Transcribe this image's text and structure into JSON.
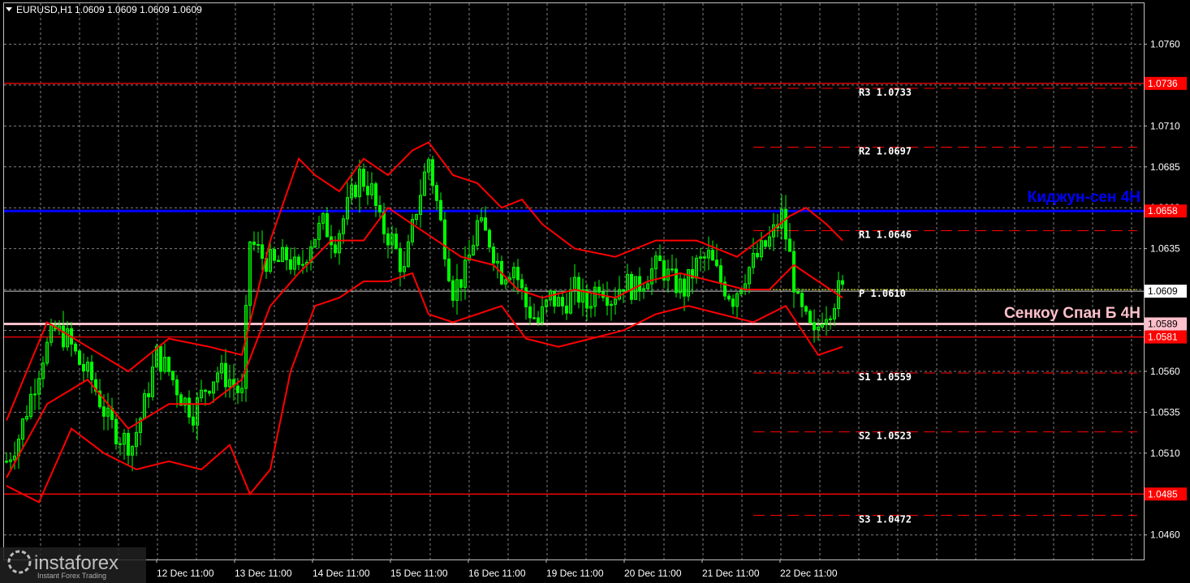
{
  "header": {
    "symbol": "EURUSD,H1",
    "ohlc": "1.0609 1.0609 1.0609 1.0609"
  },
  "watermark": {
    "brand": "instaforex",
    "tagline": "Instant Forex Trading"
  },
  "colors": {
    "background": "#000000",
    "grid": "#7f7f7f",
    "candle": "#00ff00",
    "bands": "#ff0000",
    "kijun": "#0000ff",
    "senkou": "#ffc0cb",
    "pivot": "#ffff00",
    "levels": "#ff0000"
  },
  "chart_data": {
    "type": "candlestick",
    "title": "EURUSD,H1",
    "ylim": [
      1.0445,
      1.0785
    ],
    "y_ticks": [
      "1.0760",
      "1.0735",
      "1.0710",
      "1.0685",
      "1.0660",
      "1.0635",
      "1.0610",
      "1.0585",
      "1.0560",
      "1.0535",
      "1.0510",
      "1.0485",
      "1.0460"
    ],
    "x_ticks": [
      "12 Dec 11:00",
      "13 Dec 11:00",
      "14 Dec 11:00",
      "15 Dec 11:00",
      "16 Dec 11:00",
      "19 Dec 11:00",
      "20 Dec 11:00",
      "21 Dec 11:00",
      "22 Dec 11:00"
    ],
    "price_path": [
      [
        0,
        1.0505
      ],
      [
        3,
        1.052
      ],
      [
        6,
        1.0545
      ],
      [
        9,
        1.057
      ],
      [
        12,
        1.0585
      ],
      [
        15,
        1.058
      ],
      [
        18,
        1.0565
      ],
      [
        21,
        1.0555
      ],
      [
        25,
        1.053
      ],
      [
        28,
        1.052
      ],
      [
        31,
        1.0515
      ],
      [
        34,
        1.054
      ],
      [
        37,
        1.057
      ],
      [
        40,
        1.056
      ],
      [
        43,
        1.0545
      ],
      [
        46,
        1.0535
      ],
      [
        49,
        1.055
      ],
      [
        52,
        1.056
      ],
      [
        55,
        1.0555
      ],
      [
        58,
        1.0545
      ],
      [
        60,
        1.064
      ],
      [
        63,
        1.063
      ],
      [
        66,
        1.0625
      ],
      [
        69,
        1.063
      ],
      [
        72,
        1.062
      ],
      [
        75,
        1.064
      ],
      [
        78,
        1.065
      ],
      [
        81,
        1.064
      ],
      [
        84,
        1.066
      ],
      [
        87,
        1.068
      ],
      [
        90,
        1.067
      ],
      [
        92,
        1.065
      ],
      [
        95,
        1.064
      ],
      [
        98,
        1.062
      ],
      [
        101,
        1.066
      ],
      [
        104,
        1.069
      ],
      [
        107,
        1.065
      ],
      [
        110,
        1.061
      ],
      [
        113,
        1.062
      ],
      [
        116,
        1.065
      ],
      [
        119,
        1.064
      ],
      [
        122,
        1.062
      ],
      [
        125,
        1.0625
      ],
      [
        128,
        1.06
      ],
      [
        131,
        1.059
      ],
      [
        134,
        1.0605
      ],
      [
        137,
        1.06
      ],
      [
        140,
        1.061
      ],
      [
        143,
        1.06
      ],
      [
        146,
        1.0615
      ],
      [
        149,
        1.0605
      ],
      [
        152,
        1.0615
      ],
      [
        155,
        1.061
      ],
      [
        158,
        1.062
      ],
      [
        161,
        1.0625
      ],
      [
        164,
        1.0615
      ],
      [
        167,
        1.061
      ],
      [
        170,
        1.0625
      ],
      [
        173,
        1.063
      ],
      [
        176,
        1.0615
      ],
      [
        179,
        1.0605
      ],
      [
        182,
        1.062
      ],
      [
        185,
        1.063
      ],
      [
        188,
        1.064
      ],
      [
        191,
        1.0655
      ],
      [
        193,
        1.063
      ],
      [
        195,
        1.06
      ],
      [
        197,
        1.059
      ],
      [
        199,
        1.058
      ],
      [
        201,
        1.0595
      ],
      [
        203,
        1.06
      ],
      [
        205,
        1.0609
      ]
    ],
    "bands": {
      "upper": [
        [
          0,
          1.053
        ],
        [
          10,
          1.059
        ],
        [
          20,
          1.0575
        ],
        [
          30,
          1.056
        ],
        [
          40,
          1.058
        ],
        [
          50,
          1.0575
        ],
        [
          58,
          1.057
        ],
        [
          65,
          1.064
        ],
        [
          72,
          1.069
        ],
        [
          76,
          1.068
        ],
        [
          82,
          1.067
        ],
        [
          88,
          1.069
        ],
        [
          94,
          1.068
        ],
        [
          100,
          1.0695
        ],
        [
          104,
          1.07
        ],
        [
          110,
          1.068
        ],
        [
          116,
          1.0675
        ],
        [
          122,
          1.066
        ],
        [
          127,
          1.0665
        ],
        [
          132,
          1.065
        ],
        [
          140,
          1.0635
        ],
        [
          150,
          1.063
        ],
        [
          160,
          1.064
        ],
        [
          170,
          1.064
        ],
        [
          180,
          1.063
        ],
        [
          188,
          1.0645
        ],
        [
          193,
          1.0655
        ],
        [
          197,
          1.066
        ],
        [
          202,
          1.065
        ],
        [
          206,
          1.064
        ]
      ],
      "middle": [
        [
          0,
          1.0495
        ],
        [
          10,
          1.054
        ],
        [
          20,
          1.0555
        ],
        [
          30,
          1.0525
        ],
        [
          40,
          1.054
        ],
        [
          50,
          1.054
        ],
        [
          58,
          1.0555
        ],
        [
          65,
          1.06
        ],
        [
          72,
          1.062
        ],
        [
          80,
          1.064
        ],
        [
          88,
          1.064
        ],
        [
          94,
          1.066
        ],
        [
          100,
          1.065
        ],
        [
          106,
          1.064
        ],
        [
          112,
          1.063
        ],
        [
          120,
          1.0625
        ],
        [
          126,
          1.061
        ],
        [
          132,
          1.0605
        ],
        [
          140,
          1.061
        ],
        [
          150,
          1.0605
        ],
        [
          158,
          1.0615
        ],
        [
          166,
          1.062
        ],
        [
          174,
          1.0615
        ],
        [
          182,
          1.061
        ],
        [
          188,
          1.061
        ],
        [
          194,
          1.0625
        ],
        [
          200,
          1.0615
        ],
        [
          206,
          1.0605
        ]
      ],
      "lower": [
        [
          0,
          1.049
        ],
        [
          8,
          1.048
        ],
        [
          16,
          1.0525
        ],
        [
          24,
          1.051
        ],
        [
          32,
          1.05
        ],
        [
          40,
          1.0505
        ],
        [
          48,
          1.05
        ],
        [
          55,
          1.0515
        ],
        [
          60,
          1.0485
        ],
        [
          65,
          1.05
        ],
        [
          70,
          1.056
        ],
        [
          76,
          1.06
        ],
        [
          82,
          1.0605
        ],
        [
          88,
          1.0615
        ],
        [
          94,
          1.0615
        ],
        [
          100,
          1.062
        ],
        [
          104,
          1.0595
        ],
        [
          110,
          1.059
        ],
        [
          116,
          1.0595
        ],
        [
          122,
          1.06
        ],
        [
          128,
          1.058
        ],
        [
          136,
          1.0575
        ],
        [
          144,
          1.058
        ],
        [
          152,
          1.0585
        ],
        [
          160,
          1.0595
        ],
        [
          168,
          1.06
        ],
        [
          176,
          1.0595
        ],
        [
          184,
          1.059
        ],
        [
          192,
          1.06
        ],
        [
          196,
          1.0585
        ],
        [
          200,
          1.057
        ],
        [
          206,
          1.0575
        ]
      ]
    },
    "kijun_sen": {
      "label": "Киджун-сен 4H",
      "value": "1.0658"
    },
    "senkou_span_b": {
      "label": "Сенкоу Спан Б 4H",
      "value": "1.0589"
    },
    "support_resistance": [
      "1.0736",
      "1.0581",
      "1.0485"
    ],
    "current_price": "1.0609",
    "pivots": [
      {
        "name": "R3",
        "value": "1.0733"
      },
      {
        "name": "R2",
        "value": "1.0697"
      },
      {
        "name": "R1",
        "value": "1.0646"
      },
      {
        "name": "P",
        "value": "1.0610"
      },
      {
        "name": "S1",
        "value": "1.0559"
      },
      {
        "name": "S2",
        "value": "1.0523"
      },
      {
        "name": "S3",
        "value": "1.0472"
      }
    ]
  }
}
